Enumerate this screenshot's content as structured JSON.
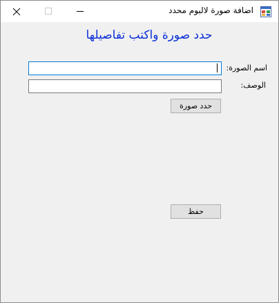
{
  "window": {
    "title": "اضافة صورة لالبوم محدد",
    "app_icon": "form-app-icon",
    "controls": {
      "minimize_icon": "minimize-icon",
      "maximize_icon": "maximize-icon",
      "close_icon": "close-icon"
    }
  },
  "form": {
    "header": "حدد صورة واكتب تفاصيلها",
    "image_name_label": "اسم الصورة:",
    "image_name_value": "",
    "description_label": "الوصف:",
    "description_value": "",
    "select_image_button": "حدد صورة",
    "save_button": "حفظ"
  },
  "colors": {
    "header_text": "#0a2fd8",
    "window_background": "#f0f0f0",
    "focused_border": "#0078d7"
  }
}
